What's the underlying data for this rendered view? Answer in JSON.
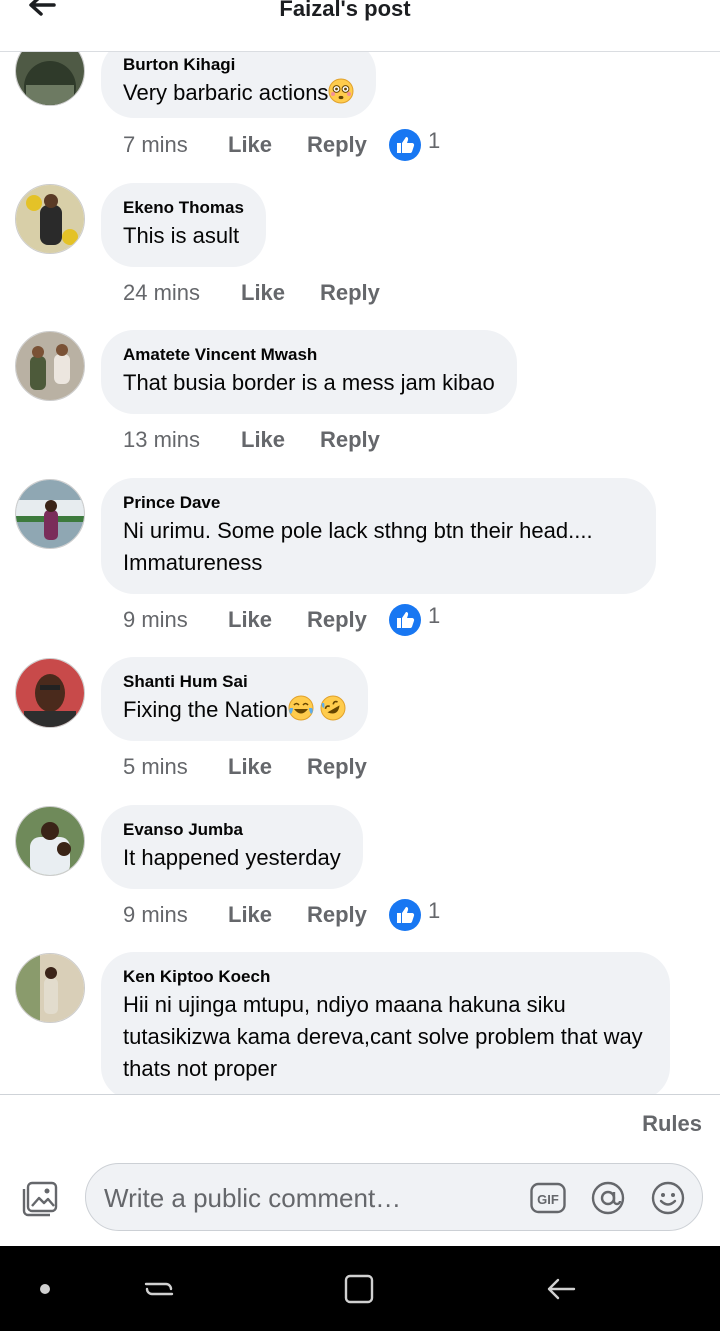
{
  "header": {
    "title": "Faizal's post"
  },
  "comments": [
    {
      "author": "Burton Kihagi",
      "text": "Very barbaric actions",
      "emojis": [
        "flushed"
      ],
      "time": "7 mins",
      "like": "Like",
      "reply": "Reply",
      "reactions": "1"
    },
    {
      "author": "Ekeno Thomas",
      "text": "This is asult",
      "time": "24 mins",
      "like": "Like",
      "reply": "Reply"
    },
    {
      "author": "Amatete Vincent Mwash",
      "text": "That busia border is a mess jam kibao",
      "time": "13 mins",
      "like": "Like",
      "reply": "Reply"
    },
    {
      "author": "Prince Dave",
      "text": "Ni urimu. Some pole lack sthng btn their head.... Immatureness",
      "time": "9 mins",
      "like": "Like",
      "reply": "Reply",
      "reactions": "1"
    },
    {
      "author": "Shanti Hum Sai",
      "text": "Fixing the Nation",
      "emojis": [
        "tears-of-joy",
        "rofl"
      ],
      "time": "5 mins",
      "like": "Like",
      "reply": "Reply"
    },
    {
      "author": "Evanso Jumba",
      "text": "It happened yesterday",
      "time": "9 mins",
      "like": "Like",
      "reply": "Reply",
      "reactions": "1"
    },
    {
      "author": "Ken Kiptoo Koech",
      "text": "Hii ni ujinga mtupu, ndiyo maana hakuna siku tutasikizwa kama dereva,cant solve problem that way thats not  proper"
    }
  ],
  "footer": {
    "rules": "Rules",
    "placeholder": "Write a public comment…",
    "gif": "GIF"
  },
  "icons": {
    "back": "arrow-left-icon",
    "like_reaction": "thumbs-up-icon",
    "photo": "photo-icon",
    "gif": "gif-icon",
    "mention": "at-sign-icon",
    "emoji": "smiley-icon",
    "nav": [
      "nav-dot-icon",
      "recent-apps-icon",
      "home-icon",
      "back-nav-icon"
    ]
  },
  "colors": {
    "accent": "#1877f2",
    "bubble": "#f0f2f5",
    "muted": "#65676b"
  }
}
